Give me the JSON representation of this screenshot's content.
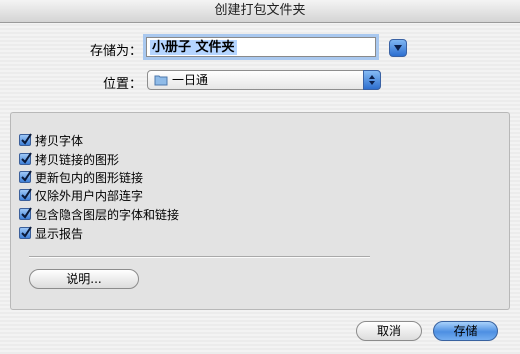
{
  "window": {
    "title": "创建打包文件夹"
  },
  "save_as": {
    "label": "存储为：",
    "value": "小册子 文件夹"
  },
  "where": {
    "label": "位置：",
    "value": "一日通"
  },
  "options": [
    {
      "label": "拷贝字体",
      "checked": true
    },
    {
      "label": "拷贝链接的图形",
      "checked": true
    },
    {
      "label": "更新包内的图形链接",
      "checked": true
    },
    {
      "label": "仅除外用户内部连字",
      "checked": true
    },
    {
      "label": "包含隐含图层的字体和链接",
      "checked": true
    },
    {
      "label": "显示报告",
      "checked": true
    }
  ],
  "buttons": {
    "instructions": "说明...",
    "cancel": "取消",
    "save": "存储"
  },
  "colors": {
    "accent": "#3d7fd9",
    "selection": "#b5d5ff"
  }
}
